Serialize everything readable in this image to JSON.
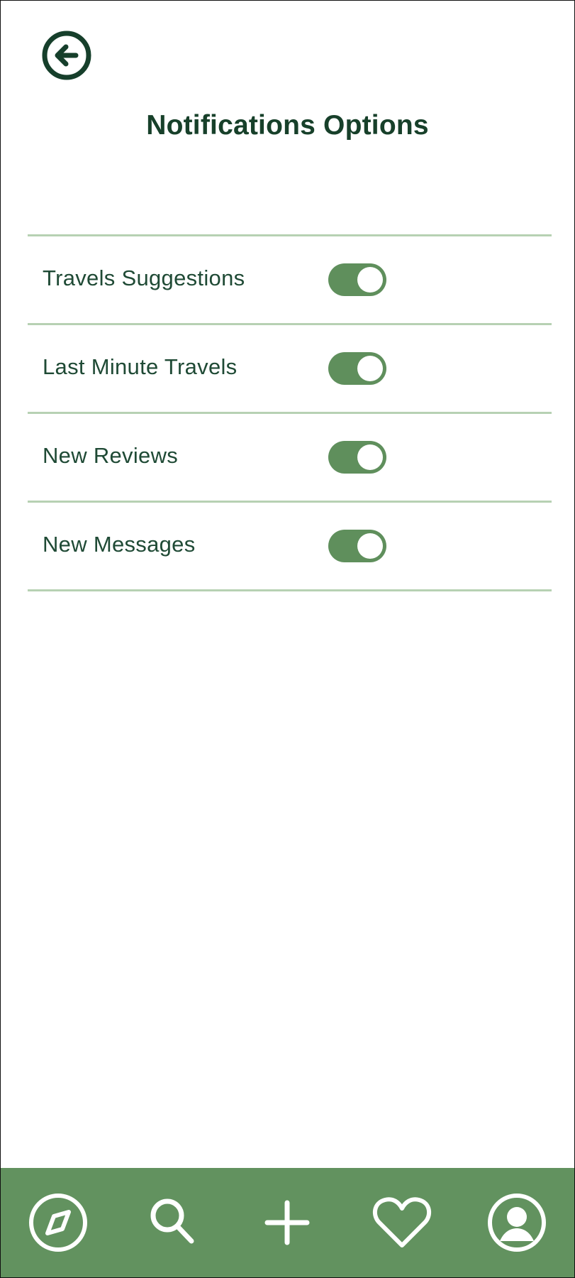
{
  "header": {
    "title": "Notifications Options",
    "back_icon": "arrow-left-circle-icon"
  },
  "settings": [
    {
      "label": "Travels Suggestions",
      "enabled": true
    },
    {
      "label": "Last Minute Travels",
      "enabled": true
    },
    {
      "label": "New Reviews",
      "enabled": true
    },
    {
      "label": "New Messages",
      "enabled": true
    }
  ],
  "bottom_nav": {
    "items": [
      {
        "icon": "compass-icon"
      },
      {
        "icon": "search-icon"
      },
      {
        "icon": "plus-icon"
      },
      {
        "icon": "heart-icon"
      },
      {
        "icon": "user-circle-icon"
      }
    ]
  },
  "colors": {
    "primary": "#62925f",
    "toggle_on": "#5f8f5c",
    "divider": "#b7d1b3",
    "text_dark": "#17402a"
  }
}
